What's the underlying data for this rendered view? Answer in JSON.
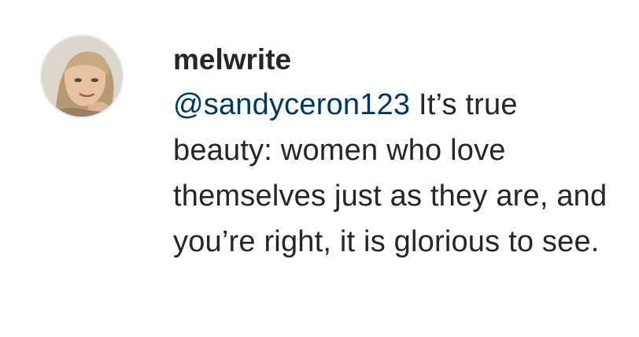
{
  "comment": {
    "avatar_icon": "user-avatar",
    "username": "melwrite",
    "mention": "@sandyceron123",
    "text": " It’s true beauty: women who love themselves just as they are, and you’re right, it is glorious to see.",
    "colors": {
      "username": "#262626",
      "mention": "#00376b",
      "text": "#262626",
      "background": "#ffffff"
    }
  }
}
